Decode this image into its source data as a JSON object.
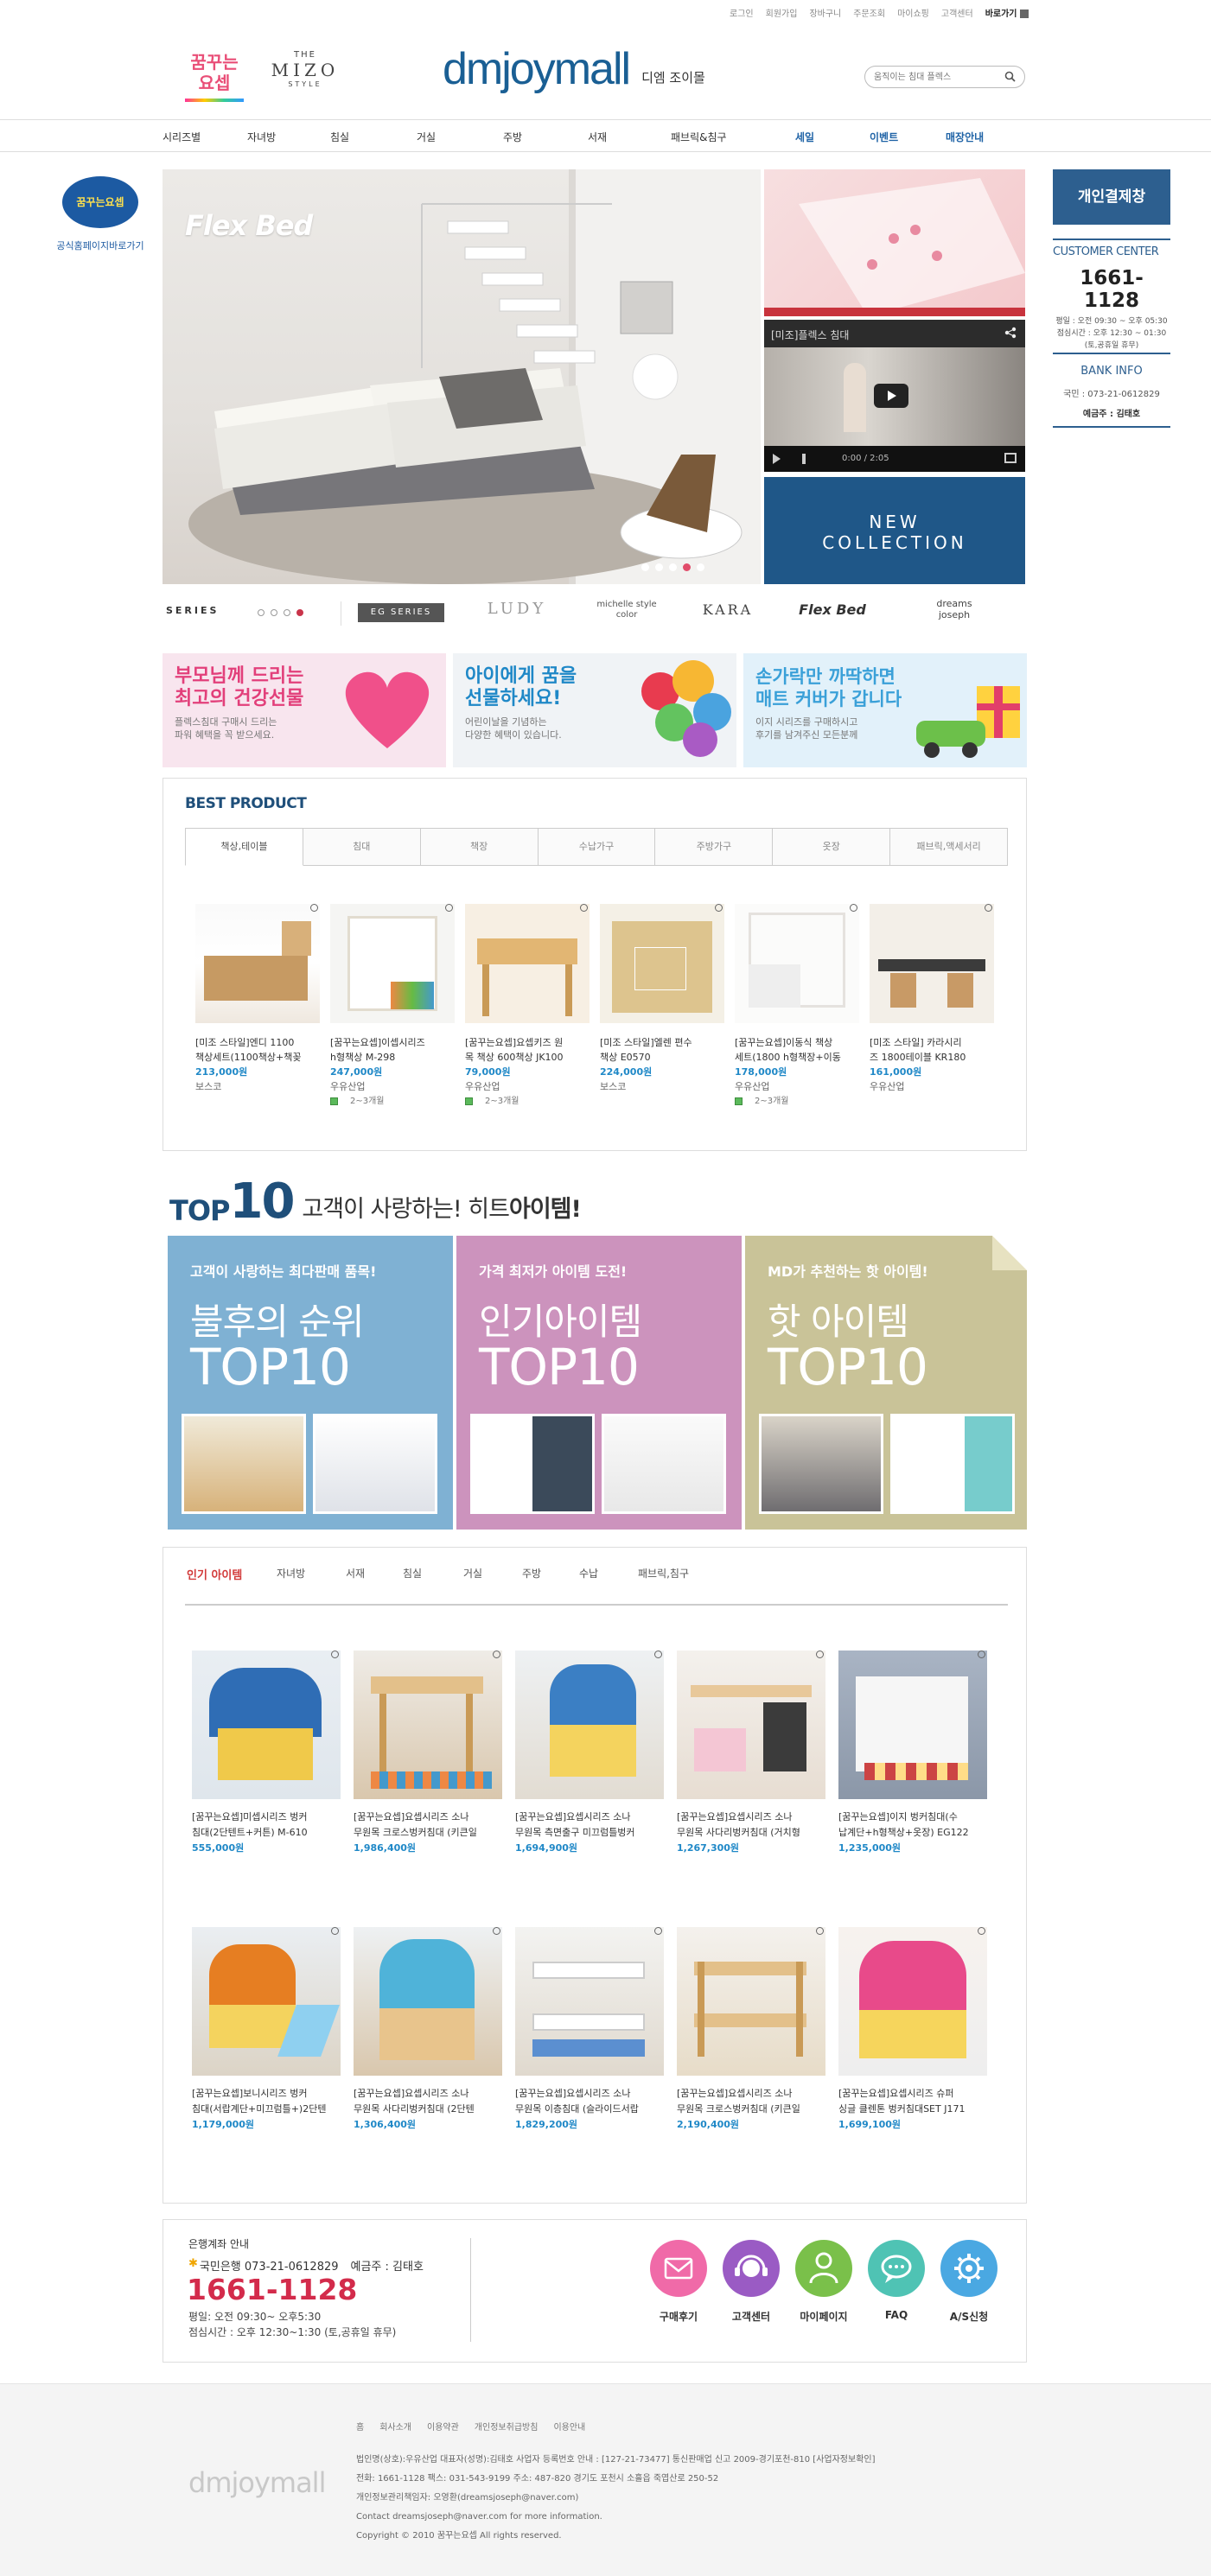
{
  "top_links": [
    "로그인",
    "회원가입",
    "장바구니",
    "주문조회",
    "마이쇼핑",
    "고객센터",
    "바로가기"
  ],
  "brand": {
    "left_logo": "꿈꾸는요셉",
    "mizo_the": "THE",
    "mizo_name": "MIZO",
    "mizo_style": "STYLE",
    "main_logo": "dmjoymall",
    "main_sub": "디엠 조이몰"
  },
  "search": {
    "placeholder": "움직이는 침대 플렉스"
  },
  "gnb": [
    "시리즈별",
    "자녀방",
    "침실",
    "거실",
    "주방",
    "서재",
    "패브릭&침구",
    "세일",
    "이벤트",
    "매장안내"
  ],
  "left_badge": {
    "logo": "꿈꾸는요셉",
    "link": "공식홈페이지바로가기"
  },
  "hero": {
    "flexbed": "Flex Bed",
    "video_title": "[미조]플렉스 침대",
    "video_time": "0:00 / 2:05",
    "new_collection_1": "NEW",
    "new_collection_2": "COLLECTION"
  },
  "series": {
    "label": "SERIES",
    "brands": [
      "EG SERIES",
      "LUDY",
      "michelle style color",
      "KARA",
      "Flex Bed",
      "dreams joseph"
    ]
  },
  "right_panel": {
    "pay_button": "개인결제창",
    "cc_title": "CUSTOMER CENTER",
    "cc_phone": "1661-1128",
    "cc_hours_1": "평일 : 오전 09:30 ~ 오후 05:30",
    "cc_hours_2": "점심시간 : 오후 12:30 ~ 01:30",
    "cc_hours_3": "(토,공휴일 휴무)",
    "bank_title": "BANK INFO",
    "bank_account": "국민 : 073-21-0612829",
    "bank_holder": "예금주 : 김태호"
  },
  "banners": [
    {
      "title_1": "부모님께 드리는",
      "title_2": "최고의 건강선물",
      "desc_1": "플렉스침대 구매시 드리는",
      "desc_2": "파워 혜택을 꼭 받으세요."
    },
    {
      "title_1": "아이에게 꿈을",
      "title_2": "선물하세요!",
      "desc_1": "어린이날을 기념하는",
      "desc_2": "다양한 혜택이 있습니다."
    },
    {
      "title_1": "손가락만 까딱하면",
      "title_2": "매트 커버가 갑니다",
      "desc_1": "이지 시리즈를 구매하시고",
      "desc_2": "후기를 남겨주신 모든분께"
    }
  ],
  "best": {
    "title": "BEST PRODUCT",
    "tabs": [
      "책상,테이블",
      "침대",
      "책장",
      "수납가구",
      "주방가구",
      "옷장",
      "패브릭,액세서리"
    ],
    "items": [
      {
        "name_1": "[미조 스타일]엔디 1100",
        "name_2": "책상세트(1100책상+책꽂",
        "price": "213,000원",
        "brand": "보스코",
        "ship": ""
      },
      {
        "name_1": "[꿈꾸는요셉]이셉시리즈",
        "name_2": "h형책상 M-298",
        "price": "247,000원",
        "brand": "우유산업",
        "ship": "2~3개월"
      },
      {
        "name_1": "[꿈꾸는요셉]요셉키즈 원",
        "name_2": "목 책상 600책상 JK100",
        "price": "79,000원",
        "brand": "우유산업",
        "ship": "2~3개월"
      },
      {
        "name_1": "[미조 스타일]엘렌 편수",
        "name_2": "책상 E0570",
        "price": "224,000원",
        "brand": "보스코",
        "ship": ""
      },
      {
        "name_1": "[꿈꾸는요셉]이동식 책상",
        "name_2": "세트(1800 h형책장+이동",
        "price": "178,000원",
        "brand": "우유산업",
        "ship": "2~3개월"
      },
      {
        "name_1": "[미조 스타일] 카라시리",
        "name_2": "즈 1800테이블 KR180",
        "price": "161,000원",
        "brand": "우유산업",
        "ship": ""
      }
    ]
  },
  "top10": {
    "top": "TOP",
    "ten": "10",
    "slogan_1": "고객이 사랑하는! 히트 ",
    "slogan_2": "아이템!",
    "cards": [
      {
        "sub": "고객이 사랑하는 최다판매 품목!",
        "title": "불후의 순위",
        "big": "TOP10"
      },
      {
        "sub": "가격 최저가 아이템 도전!",
        "title": "인기아이템",
        "big": "TOP10"
      },
      {
        "sub": "MD가 추천하는 핫 아이템!",
        "title": "핫 아이템",
        "big": "TOP10"
      }
    ]
  },
  "popular": {
    "tabs": [
      "인기 아이템",
      "자녀방",
      "서재",
      "침실",
      "거실",
      "주방",
      "수납",
      "패브릭,침구"
    ],
    "items": [
      {
        "name_1": "[꿈꾸는요셉]미셉시리즈 벙커",
        "name_2": "침대(2단텐트+커튼) M-610",
        "price": "555,000원"
      },
      {
        "name_1": "[꿈꾸는요셉]요셉시리즈 소나",
        "name_2": "무원목 크로스벙커침대 (키큰일",
        "price": "1,986,400원"
      },
      {
        "name_1": "[꿈꾸는요셉]요셉시리즈 소나",
        "name_2": "무원목 측면출구 미끄럼틀벙커",
        "price": "1,694,900원"
      },
      {
        "name_1": "[꿈꾸는요셉]요셉시리즈 소나",
        "name_2": "무원목 사다리벙커침대 (거치형",
        "price": "1,267,300원"
      },
      {
        "name_1": "[꿈꾸는요셉]이지 벙커침대(수",
        "name_2": "납계단+h형책상+옷장) EG122",
        "price": "1,235,000원"
      },
      {
        "name_1": "[꿈꾸는요셉]보니시리즈 벙커",
        "name_2": "침대(서랍계단+미끄럼틀+)2단텐",
        "price": "1,179,000원"
      },
      {
        "name_1": "[꿈꾸는요셉]요셉시리즈 소나",
        "name_2": "무원목 사다리벙커침대 (2단텐",
        "price": "1,306,400원"
      },
      {
        "name_1": "[꿈꾸는요셉]요셉시리즈 소나",
        "name_2": "무원목 이층침대 (슬라이드서랍",
        "price": "1,829,200원"
      },
      {
        "name_1": "[꿈꾸는요셉]요셉시리즈 소나",
        "name_2": "무원목 크로스벙커침대 (키큰일",
        "price": "2,190,400원"
      },
      {
        "name_1": "[꿈꾸는요셉]요셉시리즈 슈퍼",
        "name_2": "싱글 클렌톤 벙커침대SET J171",
        "price": "1,699,100원"
      }
    ]
  },
  "info": {
    "title": "은행계좌 안내",
    "bank": "국민은행 073-21-0612829",
    "holder": "예금주 : 김태호",
    "phone": "1661-1128",
    "hours_1": "평일: 오전 09:30~ 오후5:30",
    "hours_2": "점심시간 : 오후 12:30~1:30 (토,공휴일 휴무)",
    "icons": [
      {
        "label": "구매후기",
        "color": "#f06aa8",
        "icon": "mail-icon"
      },
      {
        "label": "고객센터",
        "color": "#9a5bc4",
        "icon": "headset-icon"
      },
      {
        "label": "마이페이지",
        "color": "#7ac04a",
        "icon": "user-icon"
      },
      {
        "label": "FAQ",
        "color": "#4fc3b4",
        "icon": "chat-icon"
      },
      {
        "label": "A/S신청",
        "color": "#4aa8e2",
        "icon": "gear-icon"
      }
    ]
  },
  "footer": {
    "logo": "dmjoymall",
    "links": [
      "홈",
      "회사소개",
      "이용약관",
      "개인정보취급방침",
      "이용안내"
    ],
    "line1": "법인명(상호):우유산업  대표자(성명):김태호  사업자 등록번호 안내 : [127-21-73477]  통신판매업 신고 2009-경기포천-810 [사업자정보확인]",
    "line2": "전화: 1661-1128  팩스: 031-543-9199  주소: 487-820 경기도 포천시 소흘읍 죽엽산로 250-52",
    "line3": "개인정보관리책임자: 오영환(dreamsjoseph@naver.com)",
    "line4": "Contact dreamsjoseph@naver.com for more information.",
    "line5": "Copyright © 2010 꿈꾸는요셉 All rights reserved."
  }
}
